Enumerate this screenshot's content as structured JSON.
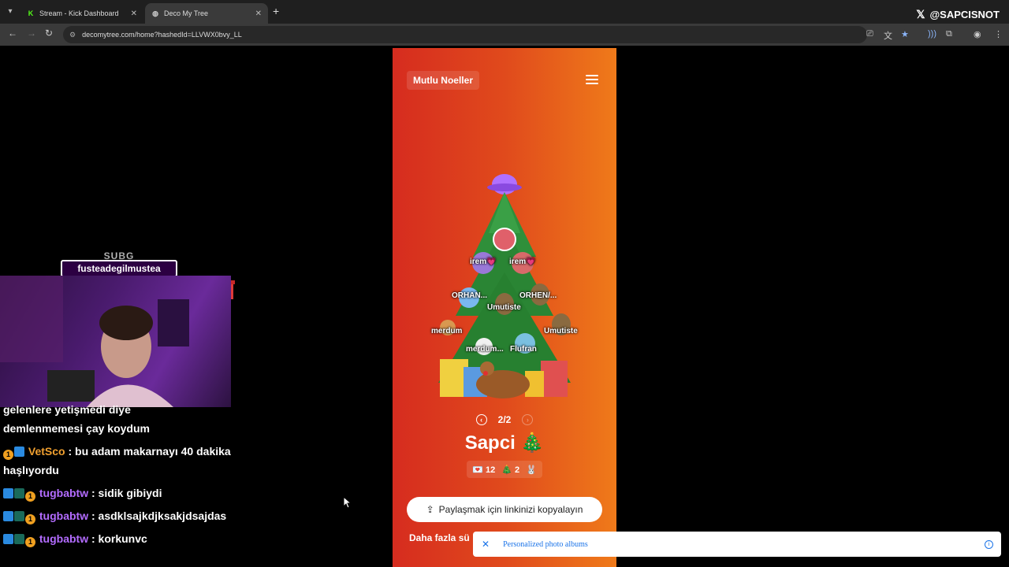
{
  "browser": {
    "tabs": [
      {
        "title": "Stream - Kick Dashboard",
        "icon": "kick-icon",
        "active": false
      },
      {
        "title": "Deco My Tree",
        "icon": "globe-icon",
        "active": true
      }
    ],
    "url": "decomytree.com/home?hashedId=LLVWX0bvy_LL",
    "overlay_handle": "@SAPCISNOT"
  },
  "app": {
    "greeting": "Mutlu Noeller",
    "ornaments": [
      {
        "label": "irem💗"
      },
      {
        "label": "irem💗"
      },
      {
        "label": "ORHAN..."
      },
      {
        "label": "Umutiste"
      },
      {
        "label": "ORHEN/..."
      },
      {
        "label": "merdum"
      },
      {
        "label": "Umutiste"
      },
      {
        "label": "merdum..."
      },
      {
        "label": "Flufran"
      }
    ],
    "pager": "2/2",
    "owner": "Sapci 🎄",
    "stats": {
      "letters": "💌 12",
      "trees": "🎄 2",
      "extra": "🐰"
    },
    "share_button": "Paylaşmak için linkinizi kopyalayın",
    "more_text": "Daha fazla sü"
  },
  "ad": {
    "text": "Personalized photo albums"
  },
  "stream_overlay": {
    "sub_label": "SUBG",
    "sub_name": "fusteadegilmustea"
  },
  "chat": [
    {
      "user": "",
      "user_color": "#ffffff",
      "message": "gelenlere yetişmedi diye"
    },
    {
      "user": "",
      "user_color": "#ffffff",
      "message": "demlenmemesi çay koydum"
    },
    {
      "user": "VetSco",
      "user_color": "#f0a030",
      "message": ": bu adam makarnayı 40 dakika haşlıyordu"
    },
    {
      "user": "tugbabtw",
      "user_color": "#b36cff",
      "message": ": sidik gibiydi"
    },
    {
      "user": "tugbabtw",
      "user_color": "#b36cff",
      "message": ": asdklsajkdjksakjdsajdas"
    },
    {
      "user": "tugbabtw",
      "user_color": "#b36cff",
      "message": ": korkunvc"
    }
  ]
}
